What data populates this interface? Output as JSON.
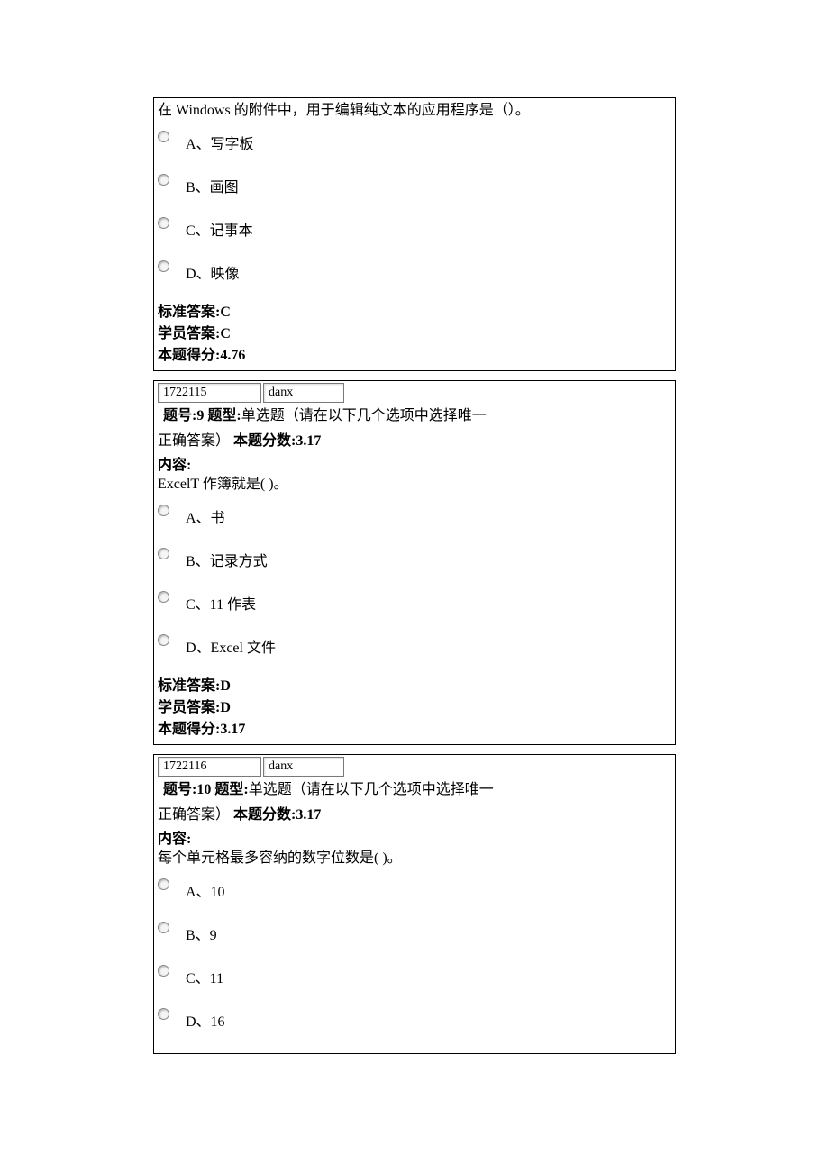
{
  "questions": [
    {
      "prev_question_text": "在 Windows 的附件中，用于编辑纯文本的应用程序是（）。",
      "options": [
        {
          "text": "A、写字板"
        },
        {
          "text": "B、画图"
        },
        {
          "text": "C、记事本"
        },
        {
          "text": "D、映像"
        }
      ],
      "standard_answer_label": "标准答案:",
      "standard_answer": "C",
      "student_answer_label": "学员答案:",
      "student_answer": "C",
      "score_label": "本题得分:",
      "score": "4.76"
    },
    {
      "id_value": "1722115",
      "type_value": "danx",
      "question_no_label": "题号:",
      "question_no": "9",
      "question_type_label": "题型:",
      "question_type": "单选题（请在以下几个选项中选择唯一",
      "header_line2": "正确答案）",
      "full_score_label": "本题分数:",
      "full_score": "3.17",
      "content_label": "内容:",
      "question_text": "ExcelT 作簿就是( )。",
      "options": [
        {
          "text": "A、书"
        },
        {
          "text": "B、记录方式"
        },
        {
          "text": "C、11 作表"
        },
        {
          "text": "D、Excel 文件"
        }
      ],
      "standard_answer_label": "标准答案:",
      "standard_answer": "D",
      "student_answer_label": "学员答案:",
      "student_answer": "D",
      "score_label": "本题得分:",
      "score": "3.17"
    },
    {
      "id_value": "1722116",
      "type_value": "danx",
      "question_no_label": "题号:",
      "question_no": "10",
      "question_type_label": "题型:",
      "question_type": "单选题（请在以下几个选项中选择唯一",
      "header_line2": "正确答案）",
      "full_score_label": "本题分数:",
      "full_score": "3.17",
      "content_label": "内容:",
      "question_text": "每个单元格最多容纳的数字位数是( )。",
      "options": [
        {
          "text": "A、10"
        },
        {
          "text": "B、9"
        },
        {
          "text": "C、11"
        },
        {
          "text": "D、16"
        }
      ]
    }
  ]
}
